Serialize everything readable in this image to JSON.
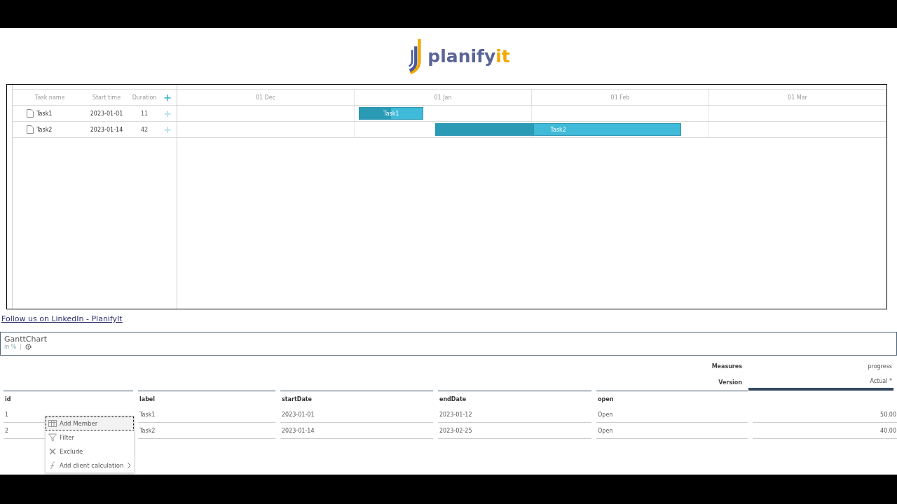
{
  "logo": {
    "text": "planify",
    "accent": "it"
  },
  "gantt": {
    "columns": [
      "Task name",
      "Start time",
      "Duration"
    ],
    "add_icon": "+",
    "timeline": [
      "01 Dec",
      "01 Jan",
      "01 Feb",
      "01 Mar"
    ],
    "tasks": [
      {
        "name": "Task1",
        "start": "2023-01-01",
        "duration": "11",
        "level": 0.5,
        "bar_label": "Task1"
      },
      {
        "name": "Task2",
        "start": "2023-01-14",
        "duration": "42",
        "level": 0.4,
        "bar_label": "Task2"
      }
    ]
  },
  "link": "Follow us on LinkedIn - PlanifyIt",
  "widget": {
    "title": "GanttChart",
    "subtitle": "in %"
  },
  "pivot": {
    "measures_label": "Measures",
    "measure": "progress",
    "version_label": "Version",
    "version": "Actual *",
    "columns": [
      "id",
      "label",
      "startDate",
      "endDate",
      "open"
    ],
    "rows": [
      [
        "1",
        "Task1",
        "2023-01-01",
        "2023-01-12",
        "Open",
        "50.00"
      ],
      [
        "2",
        "Task2",
        "2023-01-14",
        "2023-02-25",
        "Open",
        "40.00"
      ]
    ]
  },
  "context_menu": [
    {
      "label": "Add Member",
      "kind": "table",
      "selected": true,
      "submenu": false
    },
    {
      "label": "Filter",
      "kind": "filter",
      "selected": false,
      "submenu": false
    },
    {
      "label": "Exclude",
      "kind": "exclude",
      "selected": false,
      "submenu": false
    },
    {
      "label": "Add client calculation",
      "kind": "calc",
      "selected": false,
      "submenu": true
    }
  ]
}
